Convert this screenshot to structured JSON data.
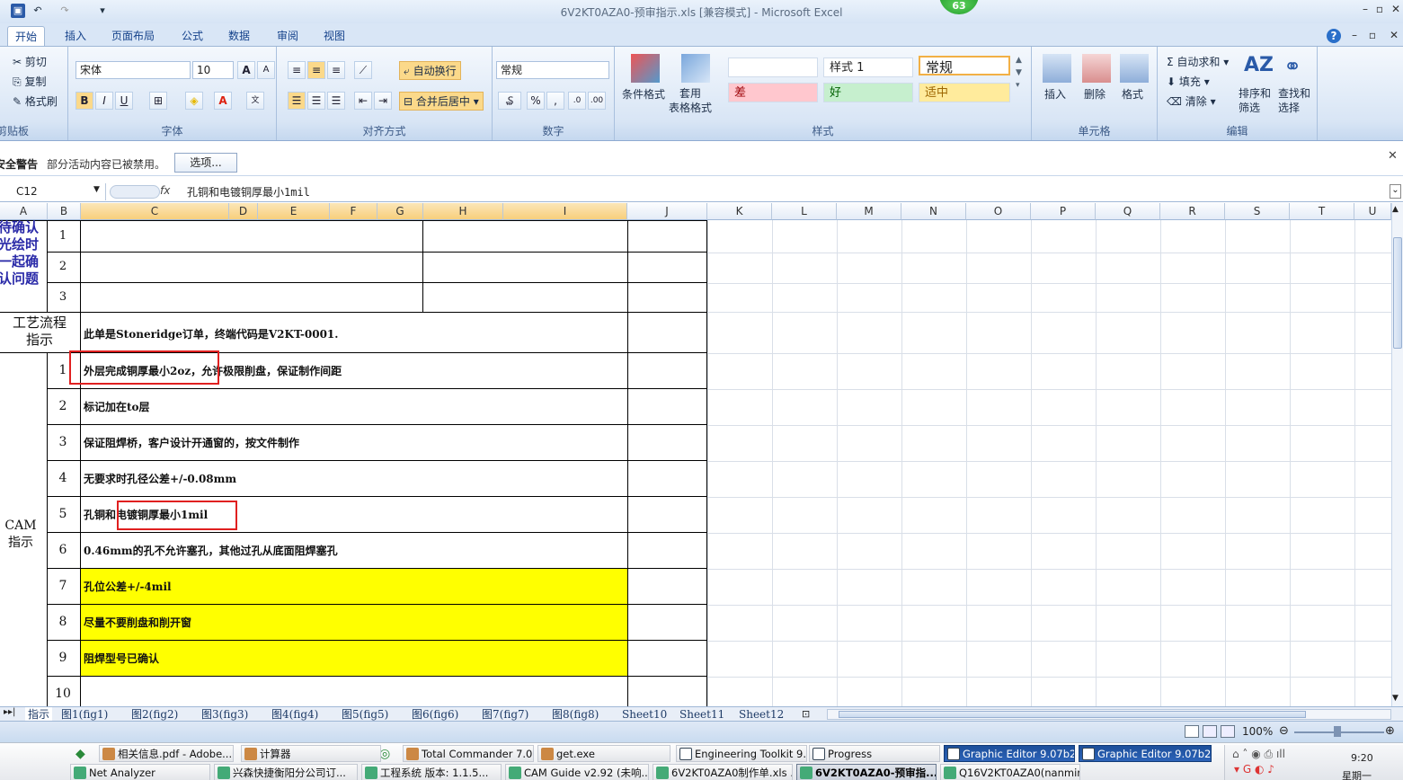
{
  "window": {
    "title": "6V2KT0AZA0-预审指示.xls [兼容模式] - Microsoft Excel",
    "badge": "63"
  },
  "ribbon_tabs": [
    "开始",
    "插入",
    "页面布局",
    "公式",
    "数据",
    "审阅",
    "视图"
  ],
  "clipboard": {
    "cut": "剪切",
    "copy": "复制",
    "painter": "格式刷",
    "label": "剪贴板"
  },
  "font": {
    "name": "宋体",
    "size": "10",
    "label": "字体",
    "bold": "B",
    "italic": "I",
    "underline": "U",
    "grow": "A",
    "shrink": "A"
  },
  "alignment": {
    "wrap": "自动换行",
    "merge": "合并后居中",
    "label": "对齐方式"
  },
  "number": {
    "format": "常规",
    "percent": "%",
    "comma": ",",
    "label": "数字"
  },
  "styles": {
    "cond_format": "条件格式",
    "table_format": "套用\n表格格式",
    "normal": "常规",
    "style1": "样式 1",
    "bad": "差",
    "good": "好",
    "neutral": "适中",
    "label": "样式"
  },
  "cells_group": {
    "insert": "插入",
    "delete": "删除",
    "format": "格式",
    "label": "单元格"
  },
  "editing": {
    "autosum": "自动求和",
    "fill": "填充",
    "clear": "清除",
    "sort": "排序和\n筛选",
    "find": "查找和\n选择",
    "label": "编辑"
  },
  "security": {
    "title": "安全警告",
    "message": "部分活动内容已被禁用。",
    "options_button": "选项..."
  },
  "formula_bar": {
    "name_box": "C12",
    "fx": "fx",
    "value": "孔铜和电镀铜厚最小1mil"
  },
  "columns": [
    "A",
    "B",
    "C",
    "D",
    "E",
    "F",
    "G",
    "H",
    "I",
    "J",
    "K",
    "L",
    "M",
    "N",
    "O",
    "P",
    "Q",
    "R",
    "S",
    "T",
    "U"
  ],
  "sheet": {
    "section1_label": "待确认\n光绘时\n一起确\n认问题",
    "section1_rows": [
      "1",
      "2",
      "3"
    ],
    "process_label": "工艺流程\n指示",
    "process_text": "此单是Stoneridge订单，终端代码是V2KT-0001.",
    "cam_label": "CAM\n指示",
    "cam_rows": [
      {
        "num": "1",
        "text": "外层完成铜厚最小2oz，允许极限削盘，保证制作间距"
      },
      {
        "num": "2",
        "text": "标记加在to层"
      },
      {
        "num": "3",
        "text": "保证阻焊桥，客户设计开通窗的，按文件制作"
      },
      {
        "num": "4",
        "text": "无要求时孔径公差+/-0.08mm"
      },
      {
        "num": "5",
        "text": "孔铜和电镀铜厚最小1mil"
      },
      {
        "num": "6",
        "text": "0.46mm的孔不允许塞孔，其他过孔从底面阻焊塞孔"
      },
      {
        "num": "7",
        "text": "孔位公差+/-4mil"
      },
      {
        "num": "8",
        "text": "尽量不要削盘和削开窗"
      },
      {
        "num": "9",
        "text": "阻焊型号已确认"
      },
      {
        "num": "10",
        "text": ""
      }
    ]
  },
  "sheet_tabs": [
    "指示",
    "图1(fig1)",
    "图2(fig2)",
    "图3(fig3)",
    "图4(fig4)",
    "图5(fig5)",
    "图6(fig6)",
    "图7(fig7)",
    "图8(fig8)",
    "Sheet10",
    "Sheet11",
    "Sheet12"
  ],
  "status": {
    "zoom": "100%"
  },
  "taskbar": {
    "row1": [
      "相关信息.pdf - Adobe...",
      "计算器",
      "Total Commander 7.0 ...",
      "get.exe",
      "Engineering Toolkit 9.0...",
      "Progress",
      "Graphic Editor 9.07b2 ...",
      "Graphic Editor 9.07b2 ..."
    ],
    "row2": [
      "Net Analyzer",
      "兴森快捷衡阳分公司订...",
      "工程系统  版本: 1.1.5...",
      "CAM  Guide v2.92 (未响...",
      "6V2KT0AZA0制作单.xls ...",
      "6V2KT0AZA0-预审指...",
      "Q16V2KT0AZA0(nanmin)..."
    ],
    "clock": "9:20",
    "day": "星期一"
  },
  "colors": {
    "highlight_yellow": "#ffff00",
    "annotation_red": "#e02020",
    "bad_bg": "#ffc7ce",
    "good_bg": "#c6efce",
    "neutral_bg": "#ffeb9c"
  }
}
